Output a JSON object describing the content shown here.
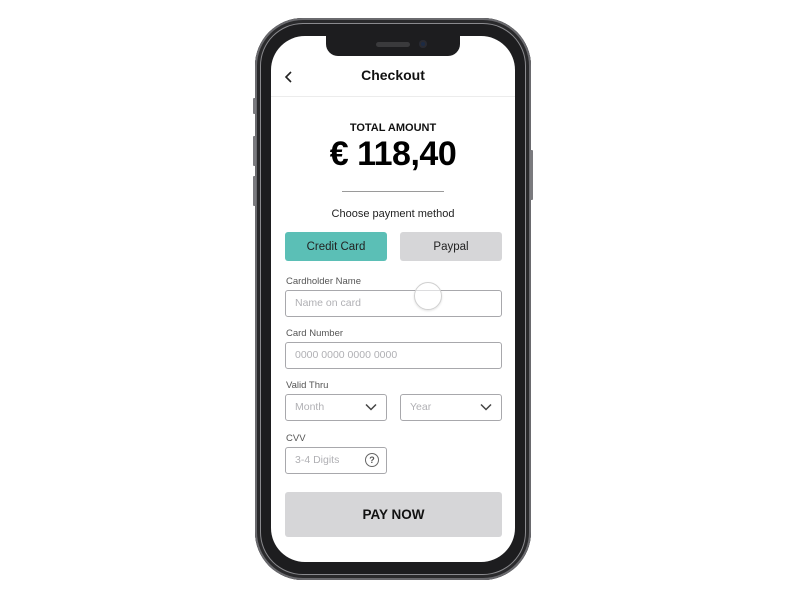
{
  "header": {
    "title": "Checkout",
    "back_icon": "chevron-left-icon"
  },
  "summary": {
    "total_label": "TOTAL AMOUNT",
    "amount": "€ 118,40"
  },
  "payment": {
    "prompt": "Choose payment method",
    "methods": [
      {
        "label": "Credit Card",
        "selected": true
      },
      {
        "label": "Paypal",
        "selected": false
      }
    ],
    "accent_color": "#5bbfb6"
  },
  "form": {
    "cardholder": {
      "label": "Cardholder Name",
      "placeholder": "Name on card",
      "value": ""
    },
    "card_number": {
      "label": "Card Number",
      "placeholder": "0000 0000 0000 0000",
      "value": ""
    },
    "valid_thru": {
      "label": "Valid Thru",
      "month_placeholder": "Month",
      "year_placeholder": "Year"
    },
    "cvv": {
      "label": "CVV",
      "placeholder": "3-4 Digits",
      "help_icon": "question-circle-icon"
    }
  },
  "actions": {
    "pay_label": "PAY NOW"
  }
}
